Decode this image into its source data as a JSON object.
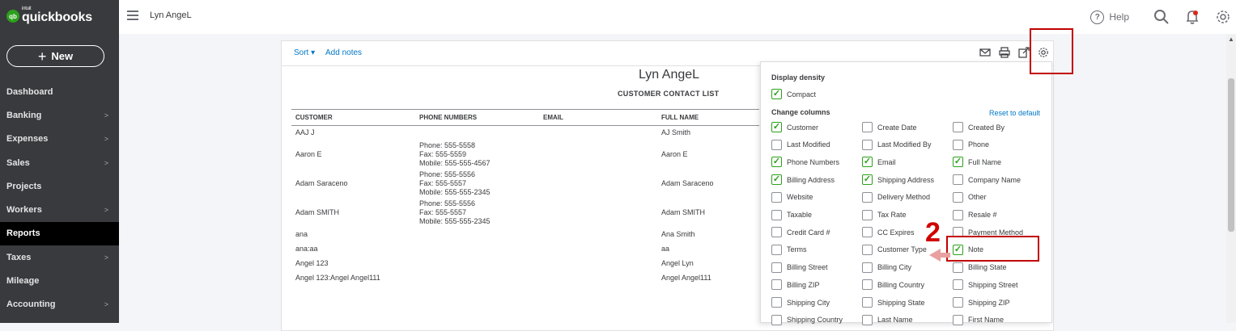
{
  "app": {
    "logo_badge": "qb",
    "logo_intuit": "intuit",
    "logo_text": "quickbooks",
    "company_name": "Lyn AngeL"
  },
  "sidebar": {
    "new_button": "New",
    "items": [
      {
        "label": "Dashboard",
        "has_chevron": false
      },
      {
        "label": "Banking",
        "has_chevron": true
      },
      {
        "label": "Expenses",
        "has_chevron": true
      },
      {
        "label": "Sales",
        "has_chevron": true
      },
      {
        "label": "Projects",
        "has_chevron": false
      },
      {
        "label": "Workers",
        "has_chevron": true
      },
      {
        "label": "Reports",
        "has_chevron": false,
        "active": true
      },
      {
        "label": "Taxes",
        "has_chevron": true
      },
      {
        "label": "Mileage",
        "has_chevron": false
      },
      {
        "label": "Accounting",
        "has_chevron": true
      }
    ]
  },
  "topbar": {
    "help_label": "Help",
    "help_icon": "?"
  },
  "report": {
    "sort_label": "Sort ▾",
    "add_notes_label": "Add notes",
    "company_title": "Lyn AngeL",
    "report_title": "CUSTOMER CONTACT LIST",
    "columns": [
      "CUSTOMER",
      "PHONE NUMBERS",
      "EMAIL",
      "FULL NAME"
    ],
    "rows": [
      {
        "customer": "AAJ J",
        "phone": [],
        "email": "",
        "full_name": "AJ Smith"
      },
      {
        "customer": "Aaron E",
        "phone": [
          "Phone: 555-5558",
          "Fax: 555-5559",
          "Mobile: 555-555-4567"
        ],
        "email": "",
        "full_name": "Aaron E"
      },
      {
        "customer": "Adam Saraceno",
        "phone": [
          "Phone: 555-5556",
          "Fax: 555-5557",
          "Mobile: 555-555-2345"
        ],
        "email": "",
        "full_name": "Adam Saraceno"
      },
      {
        "customer": "Adam SMITH",
        "phone": [
          "Phone: 555-5556",
          "Fax: 555-5557",
          "Mobile: 555-555-2345"
        ],
        "email": "",
        "full_name": "Adam SMITH"
      },
      {
        "customer": "ana",
        "phone": [],
        "email": "",
        "full_name": "Ana Smith"
      },
      {
        "customer": "ana:aa",
        "phone": [],
        "email": "",
        "full_name": "aa"
      },
      {
        "customer": "Angel 123",
        "phone": [],
        "email": "",
        "full_name": "Angel Lyn"
      },
      {
        "customer": "Angel 123:Angel Angel111",
        "phone": [],
        "email": "",
        "full_name": "Angel Angel111"
      }
    ]
  },
  "settings_panel": {
    "display_density_label": "Display density",
    "compact_label": "Compact",
    "compact_checked": true,
    "change_columns_label": "Change columns",
    "reset_label": "Reset to default",
    "columns": [
      [
        {
          "label": "Customer",
          "checked": true
        },
        {
          "label": "Create Date",
          "checked": false
        },
        {
          "label": "Created By",
          "checked": false
        }
      ],
      [
        {
          "label": "Last Modified",
          "checked": false
        },
        {
          "label": "Last Modified By",
          "checked": false
        },
        {
          "label": "Phone",
          "checked": false
        }
      ],
      [
        {
          "label": "Phone Numbers",
          "checked": true
        },
        {
          "label": "Email",
          "checked": true
        },
        {
          "label": "Full Name",
          "checked": true
        }
      ],
      [
        {
          "label": "Billing Address",
          "checked": true
        },
        {
          "label": "Shipping Address",
          "checked": true
        },
        {
          "label": "Company Name",
          "checked": false
        }
      ],
      [
        {
          "label": "Website",
          "checked": false
        },
        {
          "label": "Delivery Method",
          "checked": false
        },
        {
          "label": "Other",
          "checked": false
        }
      ],
      [
        {
          "label": "Taxable",
          "checked": false
        },
        {
          "label": "Tax Rate",
          "checked": false
        },
        {
          "label": "Resale #",
          "checked": false
        }
      ],
      [
        {
          "label": "Credit Card #",
          "checked": false
        },
        {
          "label": "CC Expires",
          "checked": false
        },
        {
          "label": "Payment Method",
          "checked": false
        }
      ],
      [
        {
          "label": "Terms",
          "checked": false
        },
        {
          "label": "Customer Type",
          "checked": false
        },
        {
          "label": "Note",
          "checked": true
        }
      ],
      [
        {
          "label": "Billing Street",
          "checked": false
        },
        {
          "label": "Billing City",
          "checked": false
        },
        {
          "label": "Billing State",
          "checked": false
        }
      ],
      [
        {
          "label": "Billing ZIP",
          "checked": false
        },
        {
          "label": "Billing Country",
          "checked": false
        },
        {
          "label": "Shipping Street",
          "checked": false
        }
      ],
      [
        {
          "label": "Shipping City",
          "checked": false
        },
        {
          "label": "Shipping State",
          "checked": false
        },
        {
          "label": "Shipping ZIP",
          "checked": false
        }
      ],
      [
        {
          "label": "Shipping Country",
          "checked": false
        },
        {
          "label": "Last Name",
          "checked": false
        },
        {
          "label": "First Name",
          "checked": false
        }
      ]
    ]
  },
  "annotation": {
    "step_number": "2",
    "highlight_color": "#c10000"
  },
  "colors": {
    "brand_green": "#2ca01c",
    "link_blue": "#0077c5",
    "sidebar_bg": "#393a3d"
  }
}
